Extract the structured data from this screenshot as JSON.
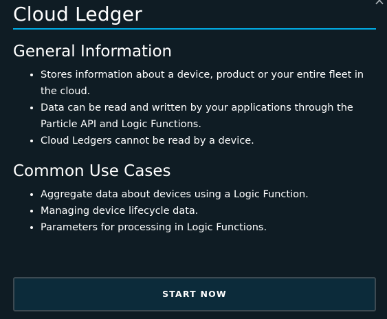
{
  "modal": {
    "title": "Cloud Ledger",
    "close_icon": "close-icon",
    "accent_color": "#00ade6",
    "background_color": "#0f1c24"
  },
  "sections": {
    "general": {
      "heading": "General Information",
      "items": [
        "Stores information about a device, product or your entire fleet in the cloud.",
        "Data can be read and written by your applications through the Particle API and Logic Functions.",
        "Cloud Ledgers cannot be read by a device."
      ]
    },
    "common": {
      "heading": "Common Use Cases",
      "items": [
        "Aggregate data about devices using a Logic Function.",
        "Managing device lifecycle data.",
        "Parameters for processing in Logic Functions."
      ]
    }
  },
  "actions": {
    "start_label": "START NOW"
  }
}
